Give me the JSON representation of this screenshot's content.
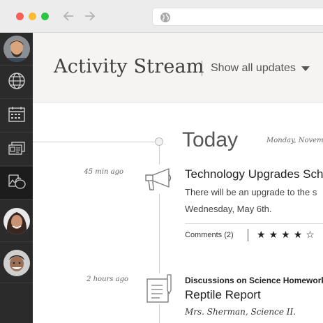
{
  "browser": {
    "traffic_lights": {
      "close": "#fc5f57",
      "minimize": "#fdbc2e",
      "maximize": "#29c840"
    },
    "back_icon": "arrow-left-icon",
    "forward_icon": "arrow-right-icon",
    "address_icon": "globe-icon",
    "address_value": ""
  },
  "sidebar": {
    "background": "#2b2b2b",
    "items": [
      {
        "name": "user-avatar-1",
        "icon": "avatar"
      },
      {
        "name": "globe",
        "icon": "globe-icon"
      },
      {
        "name": "calendar",
        "icon": "calendar-icon"
      },
      {
        "name": "cards",
        "icon": "id-card-icon"
      },
      {
        "name": "art",
        "icon": "art-icon",
        "active": true
      },
      {
        "name": "user-avatar-2",
        "icon": "avatar"
      },
      {
        "name": "user-avatar-3",
        "icon": "avatar"
      }
    ]
  },
  "header": {
    "title": "Activity Stream",
    "filter_label": "Show all updates",
    "filter_icon": "caret-down-icon"
  },
  "timeline": {
    "day_label": "Today",
    "day_date": "Monday, Novemb",
    "items": [
      {
        "time_ago": "45 min ago",
        "icon": "megaphone-icon",
        "title": "Technology Upgrades Sche",
        "body_line1": "There will be an upgrade to the s",
        "body_line2": "Wednesday, May 6th.",
        "comments_label": "Comments (2)",
        "rating": 4,
        "rating_max": 5
      },
      {
        "time_ago": "2 hours ago",
        "icon": "document-icon",
        "kicker": "Discussions on Science Homework",
        "title": "Reptile Report",
        "author": "Mrs. Sherman, Science II."
      }
    ]
  }
}
